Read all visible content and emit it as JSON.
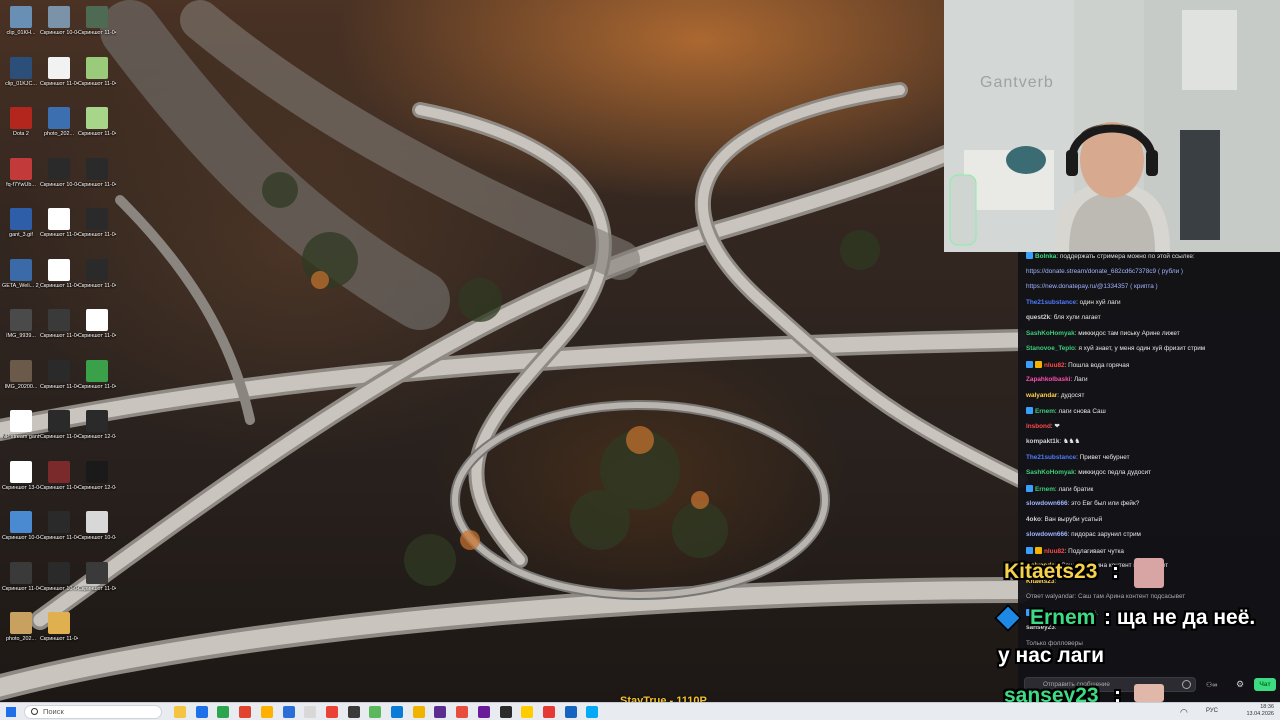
{
  "desktop": {
    "icons": [
      {
        "label": "clip_01KH...",
        "color": "#6a8fb5"
      },
      {
        "label": "Скриншот 10-04-20...",
        "color": "#7a93a8"
      },
      {
        "label": "Скриншот 11-04-20...",
        "color": "#4f6a52"
      },
      {
        "label": "clip_01KJC...",
        "color": "#2c4f7a"
      },
      {
        "label": "Скриншот 11-04-20...",
        "color": "#f2f2f2"
      },
      {
        "label": "Скриншот 11-04-20...",
        "color": "#9acb7a"
      },
      {
        "label": "Dota 2",
        "color": "#b3261e"
      },
      {
        "label": "photo_202...",
        "color": "#3c6fb0"
      },
      {
        "label": "Скриншот 11-04-20...",
        "color": "#a7d58a"
      },
      {
        "label": "fq-f7YwUb...",
        "color": "#c23a3a"
      },
      {
        "label": "Скриншот 10-04-20...",
        "color": "#2a2a2a"
      },
      {
        "label": "Скриншот 11-04-20...",
        "color": "#2a2a2a"
      },
      {
        "label": "gant_3.gif",
        "color": "#2f5ea8"
      },
      {
        "label": "Скриншот 11-04-20...",
        "color": "#ffffff"
      },
      {
        "label": "Скриншот 11-04-20...",
        "color": "#2a2a2a"
      },
      {
        "label": "GETA_Weli... 2_gantver...",
        "color": "#3a6aa8"
      },
      {
        "label": "Скриншот 11-04-20...",
        "color": "#ffffff"
      },
      {
        "label": "Скриншот 11-04-20...",
        "color": "#2a2a2a"
      },
      {
        "label": "IMG_9939...",
        "color": "#4a4a4a"
      },
      {
        "label": "Скриншот 11-04-20...",
        "color": "#3a3a3a"
      },
      {
        "label": "Скриншот 11-04-20...",
        "color": "#ffffff"
      },
      {
        "label": "IMG_20200...",
        "color": "#6b5a4a"
      },
      {
        "label": "Скриншот 11-04-20...",
        "color": "#2a2a2a"
      },
      {
        "label": "Скриншот 11-04-20...",
        "color": "#3aa04a"
      },
      {
        "label": "NP stream gantver1...",
        "color": "#ffffff"
      },
      {
        "label": "Скриншот 11-04-20...",
        "color": "#2a2a2a"
      },
      {
        "label": "Скриншот 12-04-20...",
        "color": "#2a2a2a"
      },
      {
        "label": "Скриншот 13-04-20...",
        "color": "#ffffff"
      },
      {
        "label": "Скриншот 11-04-20...",
        "color": "#7a2a2a"
      },
      {
        "label": "Скриншот 12-04-20...",
        "color": "#1a1a1a"
      },
      {
        "label": "Скриншот 10-04-20...",
        "color": "#4a8ad0"
      },
      {
        "label": "Скриншот 11-04-20...",
        "color": "#2a2a2a"
      },
      {
        "label": "Скриншот 10-04-20...",
        "color": "#d8d8d8"
      },
      {
        "label": "Скриншот 11-04-20...",
        "color": "#3a3a3a"
      },
      {
        "label": "Скриншот 10-04-20...",
        "color": "#2a2a2a"
      },
      {
        "label": "Скриншот 11-04-20...",
        "color": "#3a3a3a"
      },
      {
        "label": "photo_202...",
        "color": "#c8a060"
      },
      {
        "label": "Скриншот 11-04-20...",
        "color": "#e0b050"
      }
    ]
  },
  "webcam": {
    "wall_text": "Gantverb"
  },
  "chat": {
    "messages": [
      {
        "user": "",
        "user_color": "#dddddd",
        "text": ": поддержать стримера можно по этой ссылке:",
        "badge": "#3aa0ff",
        "prefix": "Bolnka"
      },
      {
        "user": "",
        "user_color": "#9fb5ff",
        "text": "https://donate.stream/donate_682cd6c7378c9 ( рубли )",
        "link": true
      },
      {
        "user": "",
        "user_color": "#9fb5ff",
        "text": "https://new.donatepay.ru/@1334357 ( крипта )",
        "link": true
      },
      {
        "user": "The21substance",
        "user_color": "#4d7cff",
        "text": ": один хуй лаги"
      },
      {
        "user": "quest2k",
        "user_color": "#d0d0d0",
        "text": ": бля хули лагает"
      },
      {
        "user": "SashKoHomyak",
        "user_color": "#3dcf7a",
        "text": ": миккидос там письку Арине лижет"
      },
      {
        "user": "Stanovoe_Teplo",
        "user_color": "#3dcf7a",
        "text": ": я хуй знает, у меня один хуй фризит стрим"
      },
      {
        "user": "nluu82",
        "user_color": "#ff4a4a",
        "text": ": Пошла вода горячая",
        "badge": "#3aa0ff",
        "badge2": "#f2b400"
      },
      {
        "user": "Zapahkolbaski",
        "user_color": "#ff4fb0",
        "text": ": Лаги"
      },
      {
        "user": "walyandar",
        "user_color": "#ffd24a",
        "text": ": дудосят"
      },
      {
        "user": "Ernem",
        "user_color": "#3dcf7a",
        "text": ": лаги снова Саш",
        "badge": "#3aa0ff"
      },
      {
        "user": "lnsbond",
        "user_color": "#ff4a4a",
        "text": ": ❤"
      },
      {
        "user": "kompakt1k",
        "user_color": "#d0d0d0",
        "text": ": ♞♞♞"
      },
      {
        "user": "The21substance",
        "user_color": "#4d7cff",
        "text": ": Привет чебурнет"
      },
      {
        "user": "SashKoHomyak",
        "user_color": "#3dcf7a",
        "text": ": миккидос педла дудосит"
      },
      {
        "user": "Ernem",
        "user_color": "#3dcf7a",
        "text": ": лаги братик",
        "badge": "#3aa0ff"
      },
      {
        "user": "slowdown666",
        "user_color": "#9fb5ff",
        "text": ": это Евг был или фейк?"
      },
      {
        "user": "4oko",
        "user_color": "#d0d0d0",
        "text": ": Ван выруби усатый"
      },
      {
        "user": "slowdown666",
        "user_color": "#9fb5ff",
        "text": ": пидорас зарунил стрим"
      },
      {
        "user": "nluu82",
        "user_color": "#ff4a4a",
        "text": ": Подлагивает чутка",
        "badge": "#3aa0ff",
        "badge2": "#f2b400"
      },
      {
        "user": "walyandar",
        "user_color": "#ffd24a",
        "text": ": Саш там Арина контент подсасывет"
      },
      {
        "user": "Kitaets23",
        "user_color": "#ffd24a",
        "text": ":"
      },
      {
        "user": "",
        "user_color": "#aaaaaa",
        "text": "Ответ walyandar: Саш там Арина контент подсасывет"
      },
      {
        "user": "",
        "user_color": "#3dcf7a",
        "text": "Ernem: ща не да неё.",
        "badge": "#3aa0ff"
      },
      {
        "user": "sansey23",
        "user_color": "#d0d0d0",
        "text": ":"
      },
      {
        "user": "",
        "user_color": "#aaaaaa",
        "text": "Только фолловеры"
      }
    ],
    "input_placeholder": "Отправить сообщение",
    "send_label": "Чат"
  },
  "overlay": {
    "line1_user": "Kitaets23",
    "line1_sep": ":",
    "line2_user": "Ernem",
    "line2_text": ": ща не да неё.",
    "line3_text": "у нас лаги",
    "line4_user": "sansey23",
    "line4_sep": ":",
    "stream_label": "StayTrue - 1110P"
  },
  "taskbar": {
    "search_placeholder": "Поиск",
    "lang": "РУС",
    "time": "18:36",
    "date": "13.04.2026",
    "icon_colors": [
      "#f5c542",
      "#1f6feb",
      "#2da44e",
      "#e0442f",
      "#ffb000",
      "#2a6fd6",
      "#d8d8d8",
      "#ea4335",
      "#3a3a3a",
      "#5cb85c",
      "#0a7cd8",
      "#f0b400",
      "#5c2d91",
      "#e84c3d",
      "#6a1b9a",
      "#2b2b2b",
      "#ffcc00",
      "#e53935",
      "#1565c0",
      "#03a9f4"
    ]
  }
}
